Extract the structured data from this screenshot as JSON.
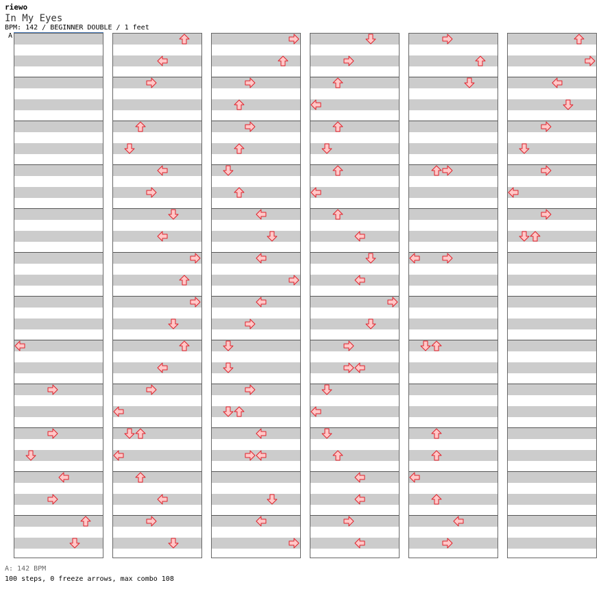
{
  "header": {
    "artist": "riewo",
    "title": "In My Eyes",
    "info": "BPM: 142 / BEGINNER DOUBLE / 1 feet"
  },
  "marker": {
    "label": "A"
  },
  "footer": {
    "bpm_line": "A: 142 BPM",
    "stats": "100 steps, 0 freeze arrows, max combo 108"
  },
  "chart": {
    "colors": {
      "arrow_fill": "#ffc8c8",
      "arrow_stroke": "#e0202a",
      "stripe": "#cccccc",
      "measure_line": "#555555"
    },
    "columns": [
      {
        "arrows": [
          {
            "beat": 28,
            "lane": 0,
            "dir": "left"
          },
          {
            "beat": 32,
            "lane": 3,
            "dir": "right"
          },
          {
            "beat": 36,
            "lane": 3,
            "dir": "right"
          },
          {
            "beat": 38,
            "lane": 1,
            "dir": "down"
          },
          {
            "beat": 40,
            "lane": 4,
            "dir": "left"
          },
          {
            "beat": 42,
            "lane": 3,
            "dir": "right"
          },
          {
            "beat": 44,
            "lane": 6,
            "dir": "up"
          },
          {
            "beat": 46,
            "lane": 5,
            "dir": "down"
          }
        ]
      },
      {
        "arrows": [
          {
            "beat": 0,
            "lane": 6,
            "dir": "up"
          },
          {
            "beat": 2,
            "lane": 4,
            "dir": "left"
          },
          {
            "beat": 4,
            "lane": 3,
            "dir": "right"
          },
          {
            "beat": 8,
            "lane": 2,
            "dir": "up"
          },
          {
            "beat": 10,
            "lane": 1,
            "dir": "down"
          },
          {
            "beat": 12,
            "lane": 4,
            "dir": "left"
          },
          {
            "beat": 14,
            "lane": 3,
            "dir": "right"
          },
          {
            "beat": 16,
            "lane": 5,
            "dir": "down"
          },
          {
            "beat": 18,
            "lane": 4,
            "dir": "left"
          },
          {
            "beat": 20,
            "lane": 7,
            "dir": "right"
          },
          {
            "beat": 22,
            "lane": 6,
            "dir": "up"
          },
          {
            "beat": 24,
            "lane": 7,
            "dir": "right"
          },
          {
            "beat": 26,
            "lane": 5,
            "dir": "down"
          },
          {
            "beat": 28,
            "lane": 6,
            "dir": "up"
          },
          {
            "beat": 30,
            "lane": 4,
            "dir": "left"
          },
          {
            "beat": 32,
            "lane": 3,
            "dir": "right"
          },
          {
            "beat": 34,
            "lane": 0,
            "dir": "left"
          },
          {
            "beat": 36,
            "lane": 1,
            "dir": "down"
          },
          {
            "beat": 36,
            "lane": 2,
            "dir": "up"
          },
          {
            "beat": 38,
            "lane": 0,
            "dir": "left"
          },
          {
            "beat": 40,
            "lane": 2,
            "dir": "up"
          },
          {
            "beat": 42,
            "lane": 4,
            "dir": "left"
          },
          {
            "beat": 44,
            "lane": 3,
            "dir": "right"
          },
          {
            "beat": 46,
            "lane": 5,
            "dir": "down"
          }
        ]
      },
      {
        "arrows": [
          {
            "beat": 0,
            "lane": 7,
            "dir": "right"
          },
          {
            "beat": 2,
            "lane": 6,
            "dir": "up"
          },
          {
            "beat": 4,
            "lane": 3,
            "dir": "right"
          },
          {
            "beat": 6,
            "lane": 2,
            "dir": "up"
          },
          {
            "beat": 8,
            "lane": 3,
            "dir": "right"
          },
          {
            "beat": 10,
            "lane": 2,
            "dir": "up"
          },
          {
            "beat": 12,
            "lane": 1,
            "dir": "down"
          },
          {
            "beat": 14,
            "lane": 2,
            "dir": "up"
          },
          {
            "beat": 16,
            "lane": 4,
            "dir": "left"
          },
          {
            "beat": 18,
            "lane": 5,
            "dir": "down"
          },
          {
            "beat": 20,
            "lane": 4,
            "dir": "left"
          },
          {
            "beat": 22,
            "lane": 7,
            "dir": "right"
          },
          {
            "beat": 24,
            "lane": 4,
            "dir": "left"
          },
          {
            "beat": 26,
            "lane": 3,
            "dir": "right"
          },
          {
            "beat": 28,
            "lane": 1,
            "dir": "down"
          },
          {
            "beat": 30,
            "lane": 1,
            "dir": "down"
          },
          {
            "beat": 32,
            "lane": 3,
            "dir": "right"
          },
          {
            "beat": 34,
            "lane": 1,
            "dir": "down"
          },
          {
            "beat": 34,
            "lane": 2,
            "dir": "up"
          },
          {
            "beat": 36,
            "lane": 4,
            "dir": "left"
          },
          {
            "beat": 38,
            "lane": 3,
            "dir": "right"
          },
          {
            "beat": 38,
            "lane": 4,
            "dir": "left"
          },
          {
            "beat": 42,
            "lane": 5,
            "dir": "down"
          },
          {
            "beat": 44,
            "lane": 4,
            "dir": "left"
          },
          {
            "beat": 46,
            "lane": 7,
            "dir": "right"
          }
        ]
      },
      {
        "arrows": [
          {
            "beat": 0,
            "lane": 5,
            "dir": "down"
          },
          {
            "beat": 2,
            "lane": 3,
            "dir": "right"
          },
          {
            "beat": 4,
            "lane": 2,
            "dir": "up"
          },
          {
            "beat": 6,
            "lane": 0,
            "dir": "left"
          },
          {
            "beat": 8,
            "lane": 2,
            "dir": "up"
          },
          {
            "beat": 10,
            "lane": 1,
            "dir": "down"
          },
          {
            "beat": 12,
            "lane": 2,
            "dir": "up"
          },
          {
            "beat": 14,
            "lane": 0,
            "dir": "left"
          },
          {
            "beat": 16,
            "lane": 2,
            "dir": "up"
          },
          {
            "beat": 18,
            "lane": 4,
            "dir": "left"
          },
          {
            "beat": 20,
            "lane": 5,
            "dir": "down"
          },
          {
            "beat": 22,
            "lane": 4,
            "dir": "left"
          },
          {
            "beat": 24,
            "lane": 7,
            "dir": "right"
          },
          {
            "beat": 26,
            "lane": 5,
            "dir": "down"
          },
          {
            "beat": 28,
            "lane": 3,
            "dir": "right"
          },
          {
            "beat": 30,
            "lane": 3,
            "dir": "right"
          },
          {
            "beat": 30,
            "lane": 4,
            "dir": "left"
          },
          {
            "beat": 32,
            "lane": 1,
            "dir": "down"
          },
          {
            "beat": 34,
            "lane": 0,
            "dir": "left"
          },
          {
            "beat": 36,
            "lane": 1,
            "dir": "down"
          },
          {
            "beat": 38,
            "lane": 2,
            "dir": "up"
          },
          {
            "beat": 40,
            "lane": 4,
            "dir": "left"
          },
          {
            "beat": 42,
            "lane": 4,
            "dir": "left"
          },
          {
            "beat": 44,
            "lane": 3,
            "dir": "right"
          },
          {
            "beat": 46,
            "lane": 4,
            "dir": "left"
          }
        ]
      },
      {
        "arrows": [
          {
            "beat": 0,
            "lane": 3,
            "dir": "right"
          },
          {
            "beat": 2,
            "lane": 6,
            "dir": "up"
          },
          {
            "beat": 4,
            "lane": 5,
            "dir": "down"
          },
          {
            "beat": 12,
            "lane": 2,
            "dir": "up"
          },
          {
            "beat": 12,
            "lane": 3,
            "dir": "right"
          },
          {
            "beat": 20,
            "lane": 0,
            "dir": "left"
          },
          {
            "beat": 20,
            "lane": 3,
            "dir": "right"
          },
          {
            "beat": 28,
            "lane": 1,
            "dir": "down"
          },
          {
            "beat": 28,
            "lane": 2,
            "dir": "up"
          },
          {
            "beat": 36,
            "lane": 2,
            "dir": "up"
          },
          {
            "beat": 38,
            "lane": 2,
            "dir": "up"
          },
          {
            "beat": 40,
            "lane": 0,
            "dir": "left"
          },
          {
            "beat": 42,
            "lane": 2,
            "dir": "up"
          },
          {
            "beat": 44,
            "lane": 4,
            "dir": "left"
          },
          {
            "beat": 46,
            "lane": 3,
            "dir": "right"
          }
        ]
      },
      {
        "arrows": [
          {
            "beat": 0,
            "lane": 6,
            "dir": "up"
          },
          {
            "beat": 2,
            "lane": 7,
            "dir": "right"
          },
          {
            "beat": 4,
            "lane": 4,
            "dir": "left"
          },
          {
            "beat": 6,
            "lane": 5,
            "dir": "down"
          },
          {
            "beat": 8,
            "lane": 3,
            "dir": "right"
          },
          {
            "beat": 10,
            "lane": 1,
            "dir": "down"
          },
          {
            "beat": 12,
            "lane": 3,
            "dir": "right"
          },
          {
            "beat": 14,
            "lane": 0,
            "dir": "left"
          },
          {
            "beat": 16,
            "lane": 3,
            "dir": "right"
          },
          {
            "beat": 18,
            "lane": 1,
            "dir": "down"
          },
          {
            "beat": 18,
            "lane": 2,
            "dir": "up"
          }
        ]
      }
    ]
  }
}
